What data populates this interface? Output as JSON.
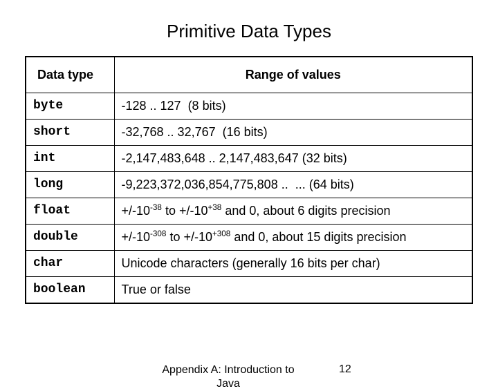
{
  "title": "Primitive Data Types",
  "table": {
    "headers": {
      "type": "Data type",
      "range": "Range of values"
    },
    "rows": [
      {
        "type": "byte",
        "range_html": "-128 .. 127&nbsp;&nbsp;(8 bits)"
      },
      {
        "type": "short",
        "range_html": "-32,768 .. 32,767&nbsp;&nbsp;(16 bits)"
      },
      {
        "type": "int",
        "range_html": "-2,147,483,648 .. 2,147,483,647 (32 bits)"
      },
      {
        "type": "long",
        "range_html": "-9,223,372,036,854,775,808 ..&nbsp;&nbsp;... (64 bits)"
      },
      {
        "type": "float",
        "range_html": "+/-10<sup>-38</sup> to +/-10<sup>+38</sup> and 0, about 6 digits precision"
      },
      {
        "type": "double",
        "range_html": "+/-10<sup>-308</sup> to +/-10<sup>+308</sup> and 0, about 15 digits precision"
      },
      {
        "type": "char",
        "range_html": "Unicode characters (generally 16 bits per char)"
      },
      {
        "type": "boolean",
        "range_html": "True or false"
      }
    ]
  },
  "footer": {
    "center": "Appendix A: Introduction to Java",
    "page": "12"
  }
}
